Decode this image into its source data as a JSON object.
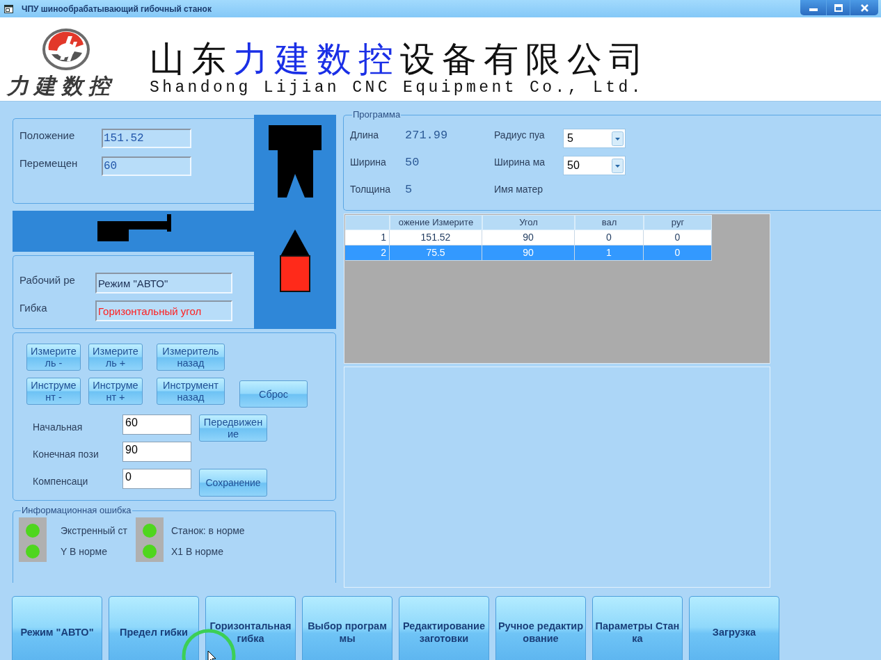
{
  "window": {
    "title": "ЧПУ шинообрабатывающий гибочный станок"
  },
  "header": {
    "logo_text": "力建数控",
    "company_name_cn": [
      {
        "text": "山东",
        "highlight": false
      },
      {
        "text": "力建数控",
        "highlight": true
      },
      {
        "text": "设备有限公司",
        "highlight": false
      }
    ],
    "company_name_en": "Shandong Lijian CNC Equipment Co., Ltd."
  },
  "position_panel": {
    "fields": [
      {
        "label": "Положение",
        "value": "151.52"
      },
      {
        "label": "Перемещен",
        "value": "60"
      }
    ]
  },
  "mode_panel": {
    "fields": [
      {
        "label": "Рабочий ре",
        "value": "Режим \"АВТО\"",
        "alert": false
      },
      {
        "label": "Гибка",
        "value": "Горизонтальный угол",
        "alert": true
      }
    ]
  },
  "jog_panel": {
    "button_rows": [
      [
        "Измеритель -",
        "Измеритель +",
        "Измеритель назад"
      ],
      [
        "Инструмент -",
        "Инструмент +",
        "Инструмент назад",
        "Сброс"
      ]
    ],
    "inputs": [
      {
        "label": "Начальная",
        "value": "60",
        "button": "Передвижение"
      },
      {
        "label": "Конечная пози",
        "value": "90"
      },
      {
        "label": "Компенсаци",
        "value": "0",
        "button": "Сохранение"
      }
    ]
  },
  "status_panel": {
    "title": "Информационная ошибка",
    "groups": [
      [
        {
          "label": "Экстренный ст",
          "ok": true
        },
        {
          "label": "Y В норме",
          "ok": true
        }
      ],
      [
        {
          "label": "Станок: в норме",
          "ok": true
        },
        {
          "label": "X1 В норме",
          "ok": true
        }
      ]
    ]
  },
  "program": {
    "title": "Программа",
    "params": [
      {
        "label": "Длина",
        "value": "271.99"
      },
      {
        "label": "Ширина",
        "value": "50"
      },
      {
        "label": "Толщина",
        "value": "5"
      }
    ],
    "settings": [
      {
        "label": "Радиус пуа",
        "kind": "dropdown",
        "value": "5"
      },
      {
        "label": "Ширина ма",
        "kind": "dropdown",
        "value": "50"
      },
      {
        "label": "Имя матер",
        "kind": "text"
      }
    ]
  },
  "table": {
    "columns": [
      "ожение Измерите",
      "Угол",
      "вал",
      "руг"
    ],
    "rows": [
      {
        "number": "1",
        "cells": [
          "151.52",
          "90",
          "0",
          "0"
        ],
        "selected": false
      },
      {
        "number": "2",
        "cells": [
          "75.5",
          "90",
          "1",
          "0"
        ],
        "selected": true
      }
    ]
  },
  "toolbar": [
    "Режим \"АВТО\"",
    "Предел гибки",
    "Горизонтальная гибка",
    "Выбор программы",
    "Редактирование заготовки",
    "Ручное редактирование",
    "Параметры Станка",
    "Загрузка"
  ]
}
